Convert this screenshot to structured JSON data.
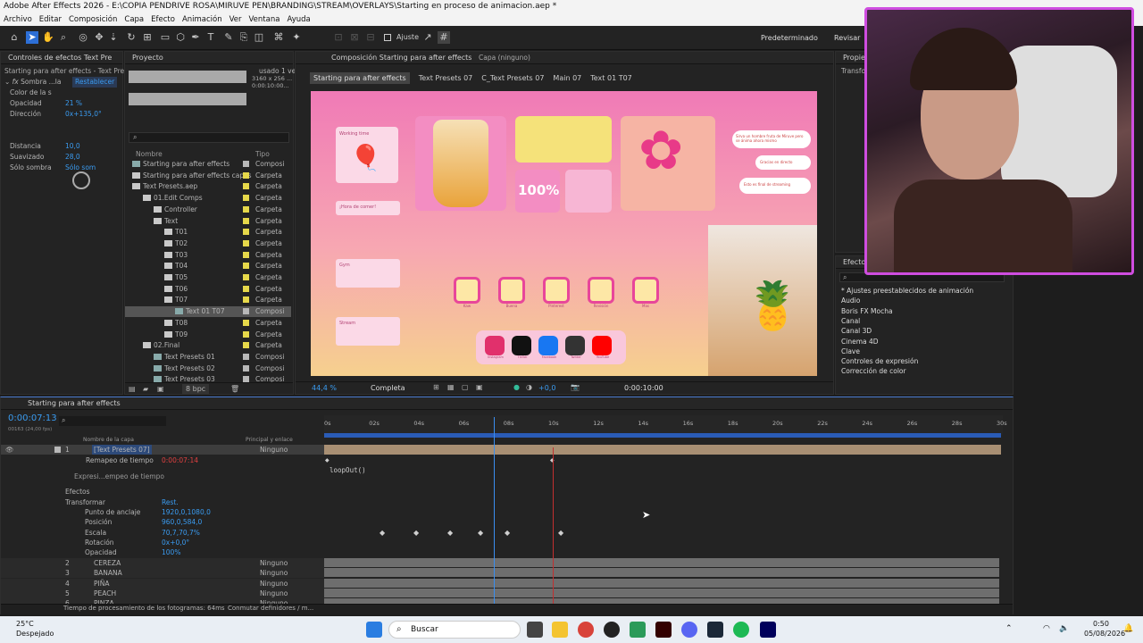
{
  "window": {
    "title": "Adobe After Effects 2026 - E:\\COPIA PENDRIVE ROSA\\MIRUVE PEN\\BRANDING\\STREAM\\OVERLAYS\\Starting en proceso de animacion.aep *"
  },
  "menu": [
    "Archivo",
    "Editar",
    "Composición",
    "Capa",
    "Efecto",
    "Animación",
    "Ver",
    "Ventana",
    "Ayuda"
  ],
  "toolbar": {
    "snap_label": "Ajuste",
    "workspace": "Predeterminado",
    "review": "Revisar"
  },
  "effects_controls": {
    "tab": "Controles de efectos Text Pre",
    "subtitle": "Starting para after effects - Text Presets 0",
    "effect_name": "Sombra ...la",
    "reset": "Restablecer",
    "props": [
      {
        "label": "Color de la s",
        "value": ""
      },
      {
        "label": "Opacidad",
        "value": "21 %"
      },
      {
        "label": "Dirección",
        "value": "0x+135,0°"
      },
      {
        "label": "Distancia",
        "value": "10,0"
      },
      {
        "label": "Suavizado",
        "value": "28,0"
      },
      {
        "label": "Sólo sombra",
        "value": "Sólo som"
      }
    ]
  },
  "project": {
    "tab": "Proyecto",
    "info_line1": "usado 1 ve",
    "info_line2": "3160 x 256 ...",
    "info_line3": "0:00:10:00...",
    "search_placeholder": "",
    "col_name": "Nombre",
    "col_type": "Tipo",
    "bpc": "8 bpc",
    "items": [
      {
        "name": "Starting para after effects",
        "type": "Composi",
        "indent": 0,
        "color": "#b8b8b8",
        "kind": "comp"
      },
      {
        "name": "Starting para after effects capas",
        "type": "Carpeta",
        "indent": 0,
        "color": "#e6d84a",
        "kind": "folder"
      },
      {
        "name": "Text Presets.aep",
        "type": "Carpeta",
        "indent": 0,
        "color": "#e6d84a",
        "kind": "folder"
      },
      {
        "name": "01.Edit Comps",
        "type": "Carpeta",
        "indent": 1,
        "color": "#e6d84a",
        "kind": "folder"
      },
      {
        "name": "Controller",
        "type": "Carpeta",
        "indent": 2,
        "color": "#e6d84a",
        "kind": "folder"
      },
      {
        "name": "Text",
        "type": "Carpeta",
        "indent": 2,
        "color": "#e6d84a",
        "kind": "folder"
      },
      {
        "name": "T01",
        "type": "Carpeta",
        "indent": 3,
        "color": "#e6d84a",
        "kind": "folder"
      },
      {
        "name": "T02",
        "type": "Carpeta",
        "indent": 3,
        "color": "#e6d84a",
        "kind": "folder"
      },
      {
        "name": "T03",
        "type": "Carpeta",
        "indent": 3,
        "color": "#e6d84a",
        "kind": "folder"
      },
      {
        "name": "T04",
        "type": "Carpeta",
        "indent": 3,
        "color": "#e6d84a",
        "kind": "folder"
      },
      {
        "name": "T05",
        "type": "Carpeta",
        "indent": 3,
        "color": "#e6d84a",
        "kind": "folder"
      },
      {
        "name": "T06",
        "type": "Carpeta",
        "indent": 3,
        "color": "#e6d84a",
        "kind": "folder"
      },
      {
        "name": "T07",
        "type": "Carpeta",
        "indent": 3,
        "color": "#e6d84a",
        "kind": "folder"
      },
      {
        "name": "Text 01 T07",
        "type": "Composi",
        "indent": 4,
        "color": "#b8b8b8",
        "kind": "comp",
        "selected": true
      },
      {
        "name": "T08",
        "type": "Carpeta",
        "indent": 3,
        "color": "#e6d84a",
        "kind": "folder"
      },
      {
        "name": "T09",
        "type": "Carpeta",
        "indent": 3,
        "color": "#e6d84a",
        "kind": "folder"
      },
      {
        "name": "02.Final",
        "type": "Carpeta",
        "indent": 1,
        "color": "#e6d84a",
        "kind": "folder"
      },
      {
        "name": "Text Presets 01",
        "type": "Composi",
        "indent": 2,
        "color": "#b8b8b8",
        "kind": "comp"
      },
      {
        "name": "Text Presets 02",
        "type": "Composi",
        "indent": 2,
        "color": "#b8b8b8",
        "kind": "comp"
      },
      {
        "name": "Text Presets 03",
        "type": "Composi",
        "indent": 2,
        "color": "#b8b8b8",
        "kind": "comp"
      }
    ]
  },
  "composition": {
    "tab": "Composición Starting para after effects",
    "layer_tab": "Capa (ninguno)",
    "breadcrumbs": [
      "Starting para after effects",
      "Text Presets 07",
      "C_Text Presets 07",
      "Main 07",
      "Text 01 T07"
    ],
    "zoom": "44,4 %",
    "resolution": "Completa",
    "exposure": "+0,0",
    "timecode": "0:00:10:00",
    "canvas": {
      "big_value": "100%",
      "todos": [
        "Working time",
        "¡Hora de comer!",
        "Gym",
        "Stream"
      ],
      "bubbles": [
        "Sirva un hombre fruta de Miruve pero se ánima ahora mismo",
        "Gracias en directo",
        "Esto es final de streaming"
      ],
      "apps": [
        "Kaw",
        "Buena",
        "Pinterest",
        "Revisión",
        "Mas"
      ],
      "socials": [
        "Instagram",
        "TikTok",
        "Facebook",
        "Twitter",
        "YouTube"
      ]
    }
  },
  "properties": {
    "tab": "Propieda",
    "section": "Transform"
  },
  "effects_presets": {
    "tab": "Efectos y",
    "items": [
      "* Ajustes preestablecidos de animación",
      "Audio",
      "Boris FX Mocha",
      "Canal",
      "Canal 3D",
      "Cinema 4D",
      "Clave",
      "Controles de expresión",
      "Corrección de color"
    ]
  },
  "timeline": {
    "tab": "Starting para after effects",
    "current_time": "0:00:07:13",
    "fps_hint": "00163 (24,00 fps)",
    "col_layer_name": "Nombre de la capa",
    "col_parent": "Principal y enlace",
    "ruler": [
      "0s",
      "02s",
      "04s",
      "06s",
      "08s",
      "10s",
      "12s",
      "14s",
      "16s",
      "18s",
      "20s",
      "22s",
      "24s",
      "26s",
      "28s",
      "30s"
    ],
    "layer1": {
      "num": "1",
      "name": "[Text Presets 07]",
      "parent": "Ninguno"
    },
    "time_remap": {
      "label": "Remapeo de tiempo",
      "value": "0:00:07:14",
      "expr_label": "Expresi...empeo de tiempo",
      "expression": "loopOut()"
    },
    "effects_label": "Efectos",
    "transform_label": "Transformar",
    "transform_reset": "Rest.",
    "transform": [
      {
        "label": "Punto de anclaje",
        "value": "1920,0,1080,0"
      },
      {
        "label": "Posición",
        "value": "960,0,584,0"
      },
      {
        "label": "Escala",
        "value": "70,7,70,7%"
      },
      {
        "label": "Rotación",
        "value": "0x+0,0°"
      },
      {
        "label": "Opacidad",
        "value": "100%"
      }
    ],
    "layers": [
      {
        "num": "2",
        "name": "CEREZA",
        "parent": "Ninguno"
      },
      {
        "num": "3",
        "name": "BANANA",
        "parent": "Ninguno"
      },
      {
        "num": "4",
        "name": "PIÑA",
        "parent": "Ninguno"
      },
      {
        "num": "5",
        "name": "PEACH",
        "parent": "Ninguno"
      },
      {
        "num": "6",
        "name": "PINZA",
        "parent": "Ninguno"
      }
    ],
    "render_time_label": "Tiempo de procesamiento de los fotogramas: 64ms",
    "toggle_label": "Conmutar definidores / m..."
  },
  "taskbar": {
    "temp": "25°C",
    "weather": "Despejado",
    "search": "Buscar",
    "time": "0:50",
    "date": "05/08/2026"
  },
  "colors": {
    "accent": "#2d8ceb",
    "canvas_pink": "#ee5aa8",
    "label_yellow": "#e6d84a",
    "playhead": "#e23b3b"
  }
}
